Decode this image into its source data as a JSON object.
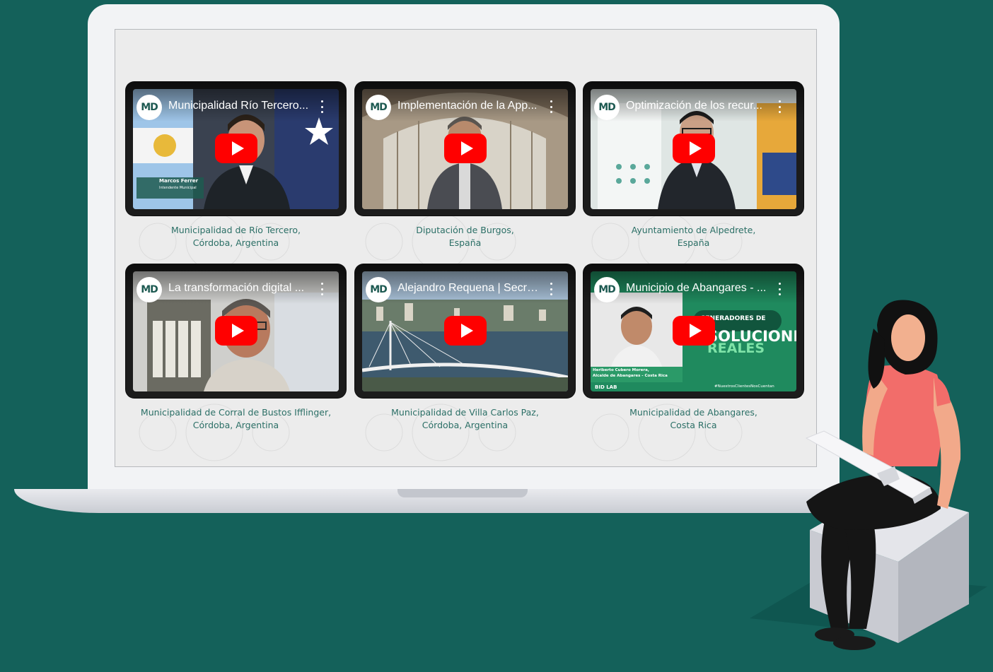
{
  "videos": [
    {
      "title": "Municipalidad Río Tercero...",
      "logo": "MD",
      "caption": [
        "Municipalidad de Río Tercero,",
        "Córdoba, Argentina"
      ],
      "overlay": [
        "Marcos Ferrer",
        "Intendente Municipal"
      ]
    },
    {
      "title": "Implementación de la App...",
      "logo": "MD",
      "caption": [
        "Diputación de Burgos,",
        "España"
      ]
    },
    {
      "title": "Optimización de los recur...",
      "logo": "MD",
      "caption": [
        "Ayuntamiento de Alpedrete,",
        "España"
      ]
    },
    {
      "title": "La transformación digital ...",
      "logo": "MD",
      "caption": [
        "Municipalidad de Corral de Bustos Ifflinger,",
        "Córdoba, Argentina"
      ]
    },
    {
      "title": "Alejandro Requena | Secre...",
      "logo": "MD",
      "caption": [
        "Municipalidad de Villa Carlos Paz,",
        "Córdoba, Argentina"
      ]
    },
    {
      "title": "Municipio de Abangares - ...",
      "logo": "MD",
      "caption": [
        "Municipalidad de Abangares,",
        "Costa Rica"
      ],
      "overlay": [
        "GENERADORES DE",
        "SOLUCIONES",
        "REALES",
        "Heriberto Cubero Morera,",
        "Alcalde de Abangares - Costa Rica",
        "BID LAB",
        "#NuestrosClientesNosCuentan"
      ]
    }
  ],
  "icons": {
    "play": "youtube-play-icon",
    "menu": "more-vert-icon"
  },
  "colors": {
    "background": "#14615a",
    "caption": "#2b6f66",
    "play": "#ff0000"
  }
}
